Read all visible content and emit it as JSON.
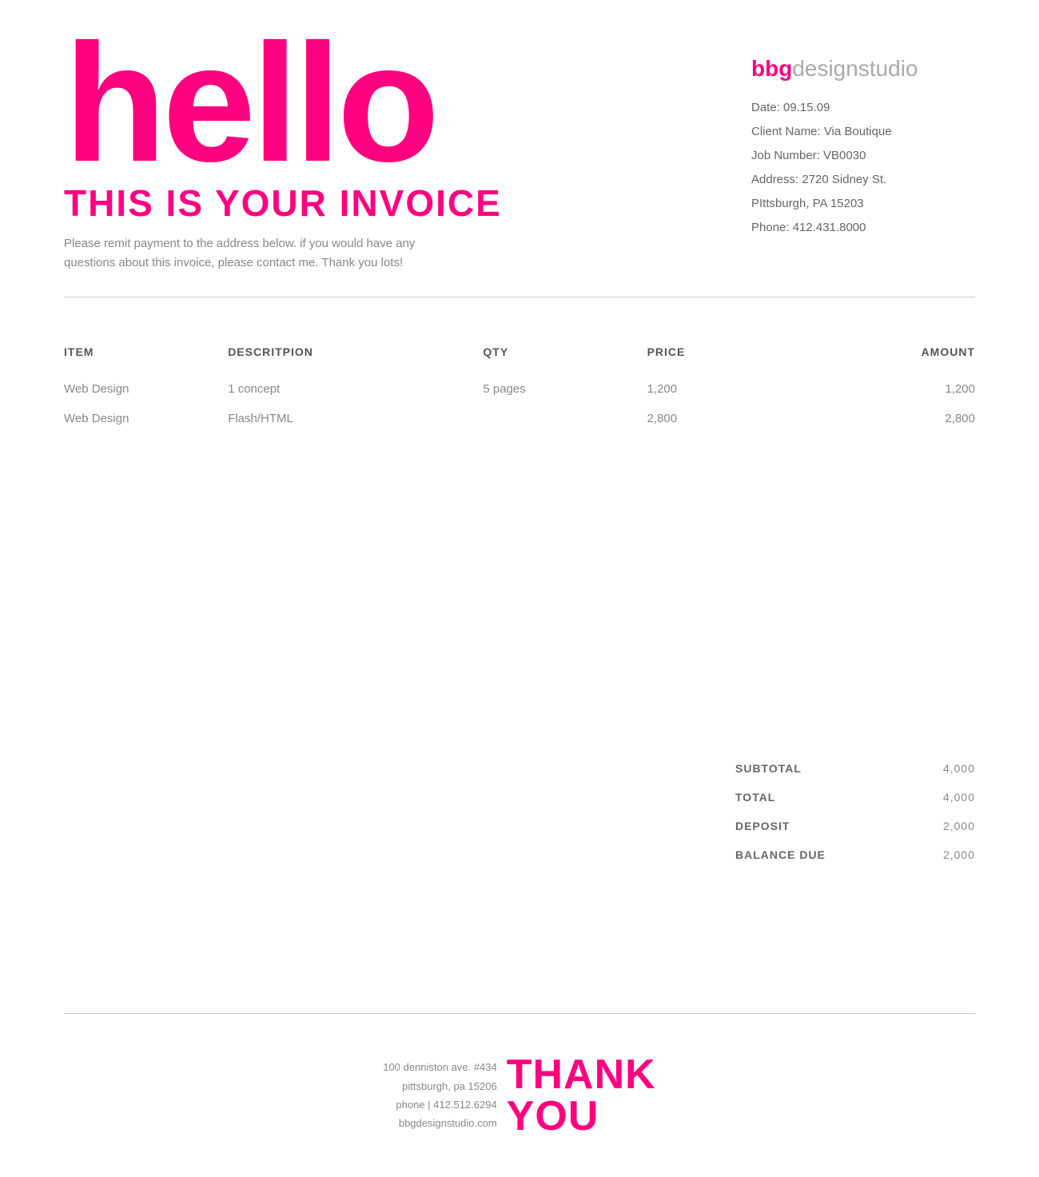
{
  "header": {
    "hello": "hello",
    "invoice_title": "THIS IS YOUR INVOICE",
    "subtitle": "Please remit payment to the address below. if you would have any questions about this invoice, please contact me. Thank you lots!",
    "studio": {
      "brand_prefix": "bbg",
      "brand_suffix": "designstudio",
      "date_label": "Date:",
      "date_value": "09.15.09",
      "client_label": "Client Name:",
      "client_value": "Via Boutique",
      "job_label": "Job Number:",
      "job_value": "VB0030",
      "address_label": "Address:",
      "address_value": "2720 Sidney St.",
      "city_value": "PIttsburgh, PA 15203",
      "phone_label": "Phone:",
      "phone_value": "412.431.8000"
    }
  },
  "table": {
    "columns": [
      "ITEM",
      "DESCRITPION",
      "QTY",
      "PRICE",
      "AMOUNT"
    ],
    "rows": [
      {
        "item": "Web Design",
        "description": "1 concept",
        "qty": "5 pages",
        "price": "1,200",
        "amount": "1,200"
      },
      {
        "item": "Web Design",
        "description": "Flash/HTML",
        "qty": "",
        "price": "2,800",
        "amount": "2,800"
      }
    ]
  },
  "totals": {
    "subtotal_label": "SUBTOTAL",
    "subtotal_value": "4,000",
    "total_label": "TOTAL",
    "total_value": "4,000",
    "deposit_label": "DEPOSIT",
    "deposit_value": "2,000",
    "balance_label": "BALANCE DUE",
    "balance_value": "2,000"
  },
  "footer": {
    "address_line1": "100 denniston ave. #434",
    "address_line2": "pittsburgh, pa 15206",
    "phone_line": "phone | 412.512.6294",
    "website": "bbgdesignstudio.com",
    "thank_you_line1": "THANK",
    "thank_you_line2": "YOU"
  }
}
